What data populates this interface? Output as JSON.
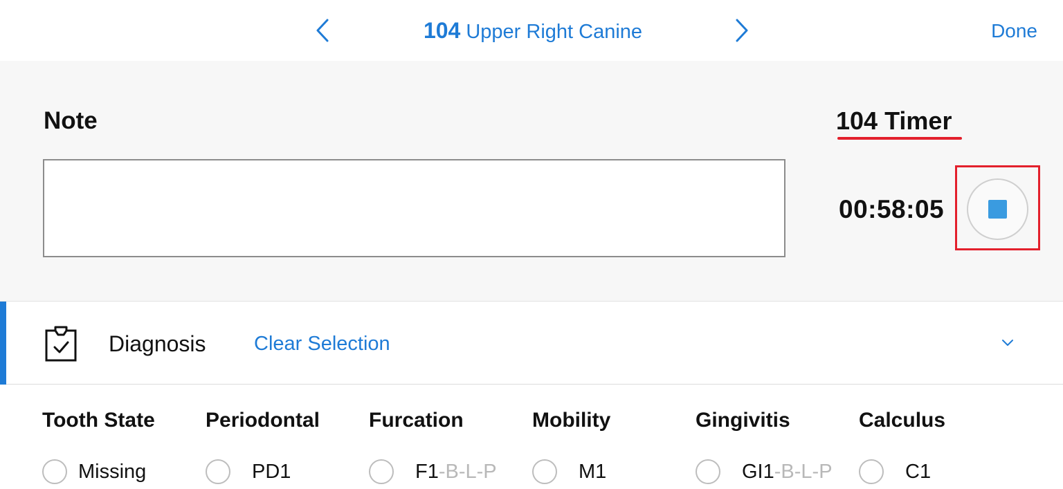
{
  "nav": {
    "tooth_number": "104",
    "tooth_name": "Upper Right Canine",
    "done_label": "Done"
  },
  "note": {
    "label": "Note",
    "value": ""
  },
  "timer": {
    "label": "104 Timer",
    "value": "00:58:05"
  },
  "diagnosis": {
    "label": "Diagnosis",
    "clear_label": "Clear Selection"
  },
  "categories": [
    {
      "header": "Tooth State",
      "option": "Missing",
      "suffix": ""
    },
    {
      "header": "Periodontal",
      "option": "PD1",
      "suffix": ""
    },
    {
      "header": "Furcation",
      "option": "F1",
      "suffix": "-B-L-P"
    },
    {
      "header": "Mobility",
      "option": "M1",
      "suffix": ""
    },
    {
      "header": "Gingivitis",
      "option": "GI1",
      "suffix": "-B-L-P"
    },
    {
      "header": "Calculus",
      "option": "C1",
      "suffix": ""
    }
  ],
  "colors": {
    "accent": "#1e7bd6",
    "highlight": "#e3202c",
    "stop": "#3a9be0"
  }
}
